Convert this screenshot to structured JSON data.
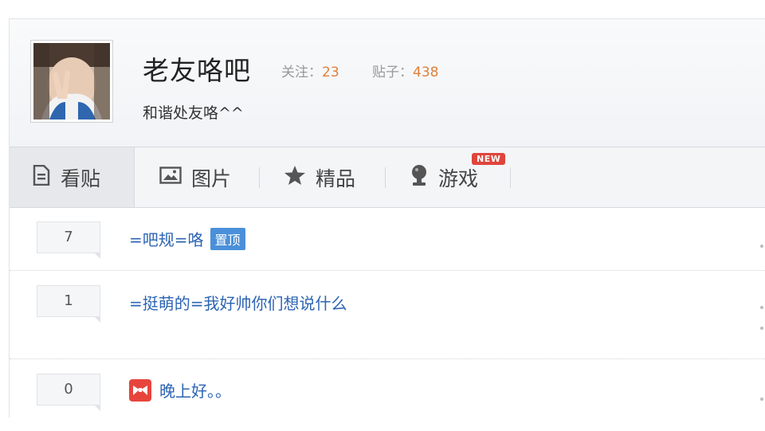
{
  "forum": {
    "name": "老友咯吧",
    "follow_label": "关注：",
    "follow_count": "23",
    "posts_label": "贴子：",
    "posts_count": "438",
    "slogan": "和谐处友咯^^"
  },
  "tabs": [
    {
      "label": "看贴",
      "icon": "document-icon",
      "active": true
    },
    {
      "label": "图片",
      "icon": "image-icon",
      "active": false
    },
    {
      "label": "精品",
      "icon": "star-icon",
      "active": false
    },
    {
      "label": "游戏",
      "icon": "game-icon",
      "active": false,
      "badge": "NEW"
    }
  ],
  "threads": [
    {
      "replies": "7",
      "title": "=吧规=咯",
      "tag": "置顶"
    },
    {
      "replies": "1",
      "title": "=挺萌的=我好帅你们想说什么"
    },
    {
      "replies": "0",
      "title": "晚上好。。",
      "emoji": "bow-emoji-icon"
    }
  ],
  "colors": {
    "link": "#2d64b3",
    "stat_number": "#e0813a",
    "pin_badge": "#4a90d9",
    "new_badge": "#e0453c"
  }
}
